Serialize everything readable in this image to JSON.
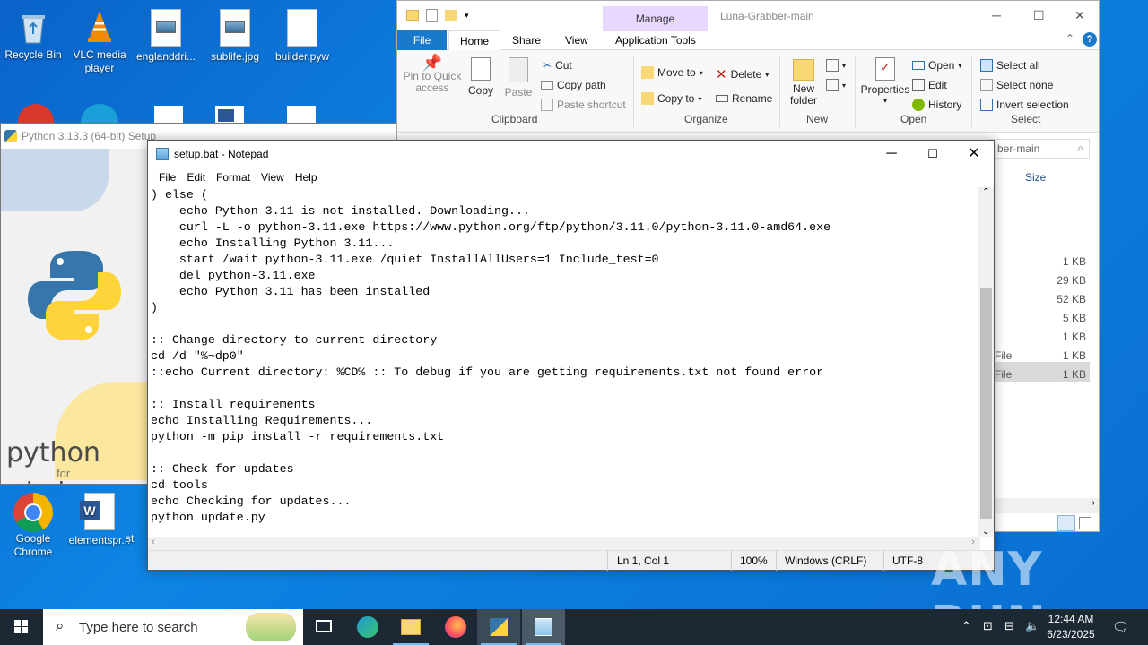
{
  "desktop": {
    "icons_top": [
      {
        "label": "Recycle Bin",
        "icon": "recycle-bin-icon"
      },
      {
        "label": "VLC media player",
        "icon": "vlc-icon"
      },
      {
        "label": "englanddri...",
        "icon": "image-file-icon"
      },
      {
        "label": "sublife.jpg",
        "icon": "image-file-icon"
      },
      {
        "label": "builder.pyw",
        "icon": "document-icon"
      }
    ],
    "icons_bottom": [
      {
        "label": "Google Chrome",
        "icon": "chrome-icon"
      },
      {
        "label": "elementspr...",
        "icon": "word-icon"
      },
      {
        "label": "st",
        "icon": "document-icon"
      }
    ]
  },
  "python_setup": {
    "title": "Python 3.13.3 (64-bit) Setup",
    "brand_word": "python",
    "brand_for": "for",
    "brand_windows": "windows"
  },
  "explorer": {
    "manage_tab": "Manage",
    "title": "Luna-Grabber-main",
    "tabs": {
      "file": "File",
      "home": "Home",
      "share": "Share",
      "view": "View",
      "app_tools": "Application Tools"
    },
    "clipboard": {
      "pin": "Pin to Quick access",
      "copy": "Copy",
      "paste": "Paste",
      "cut": "Cut",
      "copy_path": "Copy path",
      "paste_shortcut": "Paste shortcut",
      "label": "Clipboard"
    },
    "organize": {
      "move_to": "Move to",
      "copy_to": "Copy to",
      "delete": "Delete",
      "rename": "Rename",
      "label": "Organize"
    },
    "new": {
      "new_folder": "New folder",
      "label": "New"
    },
    "open": {
      "properties": "Properties",
      "open": "Open",
      "edit": "Edit",
      "history": "History",
      "label": "Open"
    },
    "select": {
      "select_all": "Select all",
      "select_none": "Select none",
      "invert": "Invert selection",
      "label": "Select"
    },
    "address_fragment": "ber-main",
    "column_size": "Size",
    "rows": [
      {
        "type": "",
        "size": "1 KB"
      },
      {
        "type": "",
        "size": "29 KB"
      },
      {
        "type": "",
        "size": "52 KB"
      },
      {
        "type": "",
        "size": "5 KB"
      },
      {
        "type": "",
        "size": "1 KB"
      },
      {
        "type": "File",
        "size": "1 KB"
      },
      {
        "type": "File",
        "size": "1 KB"
      }
    ]
  },
  "notepad": {
    "title": "setup.bat - Notepad",
    "menu": [
      "File",
      "Edit",
      "Format",
      "View",
      "Help"
    ],
    "content": ") else (\n    echo Python 3.11 is not installed. Downloading...\n    curl -L -o python-3.11.exe https://www.python.org/ftp/python/3.11.0/python-3.11.0-amd64.exe\n    echo Installing Python 3.11...\n    start /wait python-3.11.exe /quiet InstallAllUsers=1 Include_test=0\n    del python-3.11.exe\n    echo Python 3.11 has been installed\n)\n\n:: Change directory to current directory\ncd /d \"%~dp0\"\n::echo Current directory: %CD% :: To debug if you are getting requirements.txt not found error\n\n:: Install requirements\necho Installing Requirements...\npython -m pip install -r requirements.txt\n\n:: Check for updates\ncd tools\necho Checking for updates...\npython update.py",
    "status": {
      "position": "Ln 1, Col 1",
      "zoom": "100%",
      "line_ending": "Windows (CRLF)",
      "encoding": "UTF-8"
    }
  },
  "taskbar": {
    "search_placeholder": "Type here to search",
    "time": "12:44 AM",
    "date": "6/23/2025"
  },
  "watermark": "ANY RUN"
}
